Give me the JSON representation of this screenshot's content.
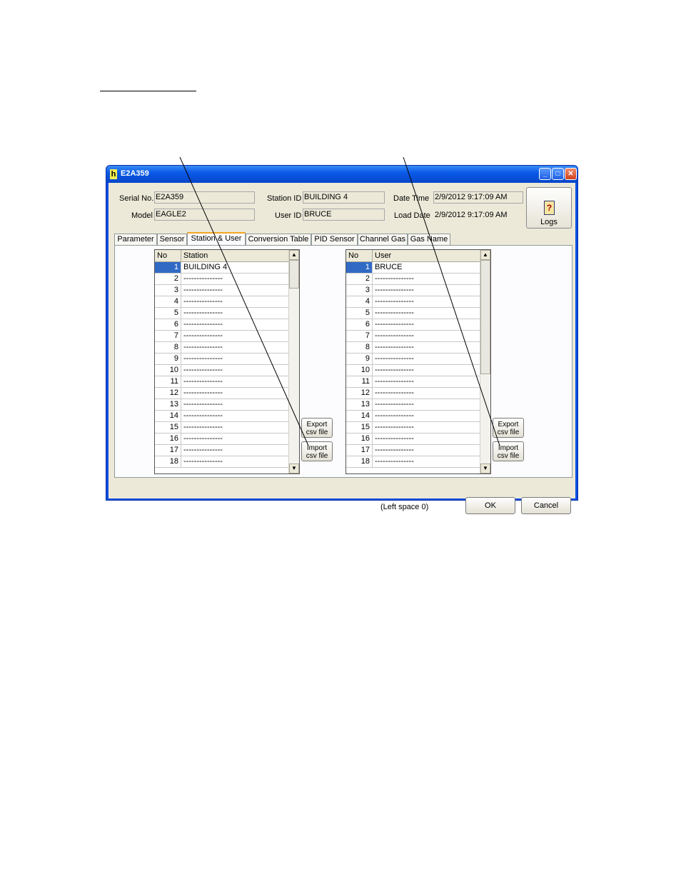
{
  "window": {
    "title": "E2A359",
    "icon": "h"
  },
  "window_controls": {
    "minimize": "_",
    "maximize": "□",
    "close": "✕"
  },
  "info": {
    "serial_label": "Serial No.",
    "serial_value": "E2A359",
    "model_label": "Model",
    "model_value": "EAGLE2",
    "station_label": "Station ID",
    "station_value": "BUILDING 4",
    "user_label": "User ID",
    "user_value": "BRUCE",
    "date_time_label": "Date Time",
    "date_time_value": "2/9/2012 9:17:09 AM",
    "load_date_label": "Load Date",
    "load_date_value": "2/9/2012 9:17:09 AM"
  },
  "logs_button": {
    "label": "Logs",
    "icon": "logbook-icon",
    "glyph": "?"
  },
  "tabs": [
    "Parameter",
    "Sensor",
    "Station & User",
    "Conversion Table",
    "PID Sensor",
    "Channel Gas",
    "Gas Name"
  ],
  "active_tab": "Station & User",
  "station_grid": {
    "col_no": "No",
    "col_value": "Station",
    "rows": [
      {
        "no": "1",
        "value": "BUILDING 4"
      },
      {
        "no": "2",
        "value": "---------------"
      },
      {
        "no": "3",
        "value": "---------------"
      },
      {
        "no": "4",
        "value": "---------------"
      },
      {
        "no": "5",
        "value": "---------------"
      },
      {
        "no": "6",
        "value": "---------------"
      },
      {
        "no": "7",
        "value": "---------------"
      },
      {
        "no": "8",
        "value": "---------------"
      },
      {
        "no": "9",
        "value": "---------------"
      },
      {
        "no": "10",
        "value": "---------------"
      },
      {
        "no": "11",
        "value": "---------------"
      },
      {
        "no": "12",
        "value": "---------------"
      },
      {
        "no": "13",
        "value": "---------------"
      },
      {
        "no": "14",
        "value": "---------------"
      },
      {
        "no": "15",
        "value": "---------------"
      },
      {
        "no": "16",
        "value": "---------------"
      },
      {
        "no": "17",
        "value": "---------------"
      },
      {
        "no": "18",
        "value": "---------------"
      }
    ],
    "export_label_1": "Export",
    "export_label_2": "csv file",
    "import_label_1": "Import",
    "import_label_2": "csv file"
  },
  "user_grid": {
    "col_no": "No",
    "col_value": "User",
    "rows": [
      {
        "no": "1",
        "value": "BRUCE"
      },
      {
        "no": "2",
        "value": "---------------"
      },
      {
        "no": "3",
        "value": "---------------"
      },
      {
        "no": "4",
        "value": "---------------"
      },
      {
        "no": "5",
        "value": "---------------"
      },
      {
        "no": "6",
        "value": "---------------"
      },
      {
        "no": "7",
        "value": "---------------"
      },
      {
        "no": "8",
        "value": "---------------"
      },
      {
        "no": "9",
        "value": "---------------"
      },
      {
        "no": "10",
        "value": "---------------"
      },
      {
        "no": "11",
        "value": "---------------"
      },
      {
        "no": "12",
        "value": "---------------"
      },
      {
        "no": "13",
        "value": "---------------"
      },
      {
        "no": "14",
        "value": "---------------"
      },
      {
        "no": "15",
        "value": "---------------"
      },
      {
        "no": "16",
        "value": "---------------"
      },
      {
        "no": "17",
        "value": "---------------"
      },
      {
        "no": "18",
        "value": "---------------"
      }
    ],
    "export_label_1": "Export",
    "export_label_2": "csv file",
    "import_label_1": "Import",
    "import_label_2": "csv file"
  },
  "footer": {
    "status": "(Left space 0)",
    "ok_label": "OK",
    "cancel_label": "Cancel"
  }
}
